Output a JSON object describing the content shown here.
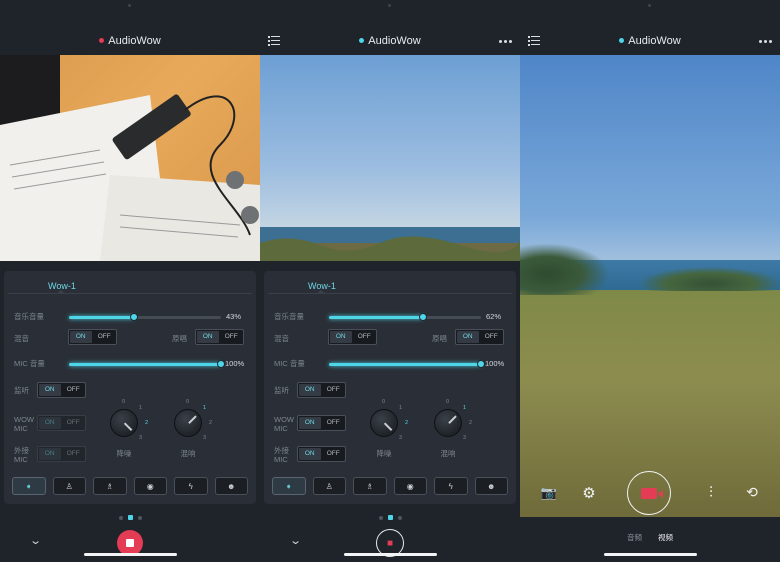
{
  "screens": [
    {
      "title": "AudioWow",
      "dot_color": "#e43c55"
    },
    {
      "title": "AudioWow",
      "dot_color": "#4fd5e8"
    },
    {
      "title": "AudioWow",
      "dot_color": "#4fd5e8"
    }
  ],
  "panels": [
    {
      "tab": "Wow-1",
      "music_volume_label": "音乐音量",
      "music_volume": "43%",
      "music_level": 0.43,
      "reverb_label": "混音",
      "reverb_on": "ON",
      "reverb_off": "OFF",
      "original_label": "原唱",
      "original_on": "ON",
      "original_off": "OFF",
      "mic_volume_label": "MIC 音量",
      "mic_volume": "100%",
      "mic_level": 1.0,
      "monitor_label": "监听",
      "monitor_on": "ON",
      "monitor_off": "OFF",
      "wow_mic_label": "WOW MIC",
      "wow_mic_on": "ON",
      "wow_mic_off": "OFF",
      "ext_mic_label": "外接 MIC",
      "ext_mic_on": "ON",
      "ext_mic_off": "OFF",
      "noise_label": "降噪",
      "echo_label": "混响",
      "noise_value": 2,
      "echo_value": 1
    },
    {
      "tab": "Wow-1",
      "music_volume_label": "音乐音量",
      "music_volume": "62%",
      "music_level": 0.62,
      "reverb_label": "混音",
      "reverb_on": "ON",
      "reverb_off": "OFF",
      "original_label": "原唱",
      "original_on": "ON",
      "original_off": "OFF",
      "mic_volume_label": "MIC 音量",
      "mic_volume": "100%",
      "mic_level": 1.0,
      "monitor_label": "监听",
      "monitor_on": "ON",
      "monitor_off": "OFF",
      "wow_mic_label": "WOW MIC",
      "wow_mic_on": "ON",
      "wow_mic_off": "OFF",
      "ext_mic_label": "外接 MIC",
      "ext_mic_on": "ON",
      "ext_mic_off": "OFF",
      "noise_label": "降噪",
      "echo_label": "混响",
      "noise_value": 2,
      "echo_value": 1
    }
  ],
  "knob_ticks": [
    "0",
    "1",
    "2",
    "3"
  ],
  "preset_icons": [
    "speaker-icon",
    "person-icon",
    "person-alt-icon",
    "mask-icon",
    "lightning-icon",
    "robot-icon"
  ],
  "preset_glyphs": [
    "➧",
    "♙",
    "♗",
    "◉",
    "ϟ",
    "☻"
  ],
  "camera": {
    "photo_icon": "📷",
    "settings_icon": "⚙",
    "eq_icon": "⫶",
    "flip_icon": "⟲",
    "mode_audio": "音频",
    "mode_video": "视频"
  },
  "colors": {
    "accent": "#4fd5e8",
    "record": "#e43c55",
    "background": "#1f232a"
  }
}
